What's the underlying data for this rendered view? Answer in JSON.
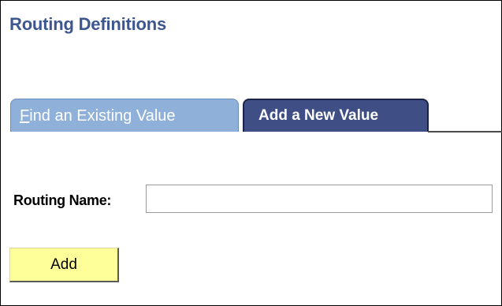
{
  "page": {
    "title": "Routing Definitions"
  },
  "tabs": [
    {
      "label_accesskey": "F",
      "label_rest": "ind an Existing Value",
      "active": false
    },
    {
      "label": "Add a New Value",
      "active": true
    }
  ],
  "form": {
    "routing_name_label": "Routing Name:",
    "routing_name_value": "",
    "add_button_label": "Add"
  },
  "colors": {
    "title": "#3d5690",
    "tab_inactive": "#8fb0d8",
    "tab_active": "#3f4f86",
    "button": "#ffff99"
  }
}
